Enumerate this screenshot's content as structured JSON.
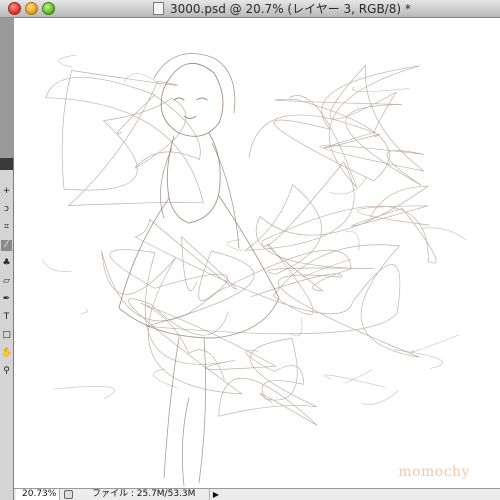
{
  "window": {
    "title": "3000.psd @ 20.7% (レイヤー 3, RGB/8) *"
  },
  "status_bar": {
    "zoom": "20.73%",
    "file_info": "ファイル : 25.7M/53.3M",
    "arrow": "▶"
  },
  "canvas": {
    "watermark": "momochy"
  },
  "tools": [
    {
      "icon": "move-icon",
      "glyph": "+"
    },
    {
      "icon": "lasso-icon",
      "glyph": "ↄ"
    },
    {
      "icon": "crop-icon",
      "glyph": "⌗"
    },
    {
      "icon": "brush-icon",
      "glyph": "⁄",
      "active": true
    },
    {
      "icon": "stamp-icon",
      "glyph": "♣"
    },
    {
      "icon": "eraser-icon",
      "glyph": "▱"
    },
    {
      "icon": "pen-icon",
      "glyph": "✒"
    },
    {
      "icon": "type-icon",
      "glyph": "T"
    },
    {
      "icon": "shape-icon",
      "glyph": "□"
    },
    {
      "icon": "hand-icon",
      "glyph": "✋"
    },
    {
      "icon": "zoom-icon",
      "glyph": "⚲"
    }
  ]
}
